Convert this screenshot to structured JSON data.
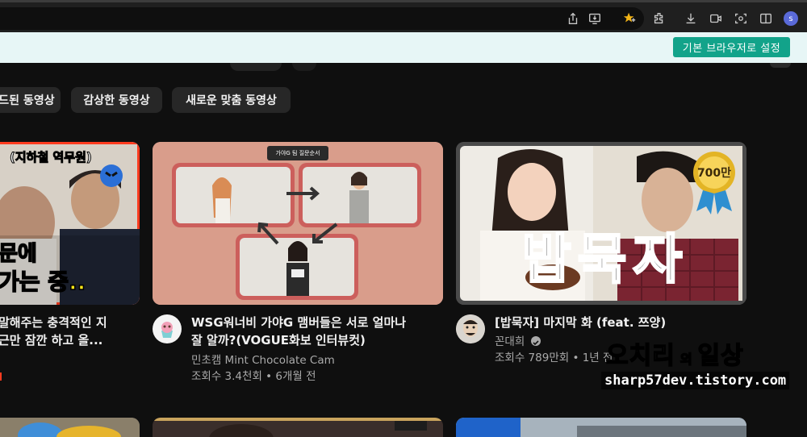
{
  "browser": {
    "profile_initial": "s",
    "infobar_button": "기본 브라우저로 설정",
    "icons": [
      "share-icon",
      "install-app-icon",
      "favorites-star-icon",
      "extensions-icon",
      "download-icon",
      "video-icon",
      "screenshot-icon",
      "split-view-icon"
    ]
  },
  "chips": [
    "로드된 동영상",
    "감상한 동영상",
    "새로운 맞춤 동영상"
  ],
  "videos": [
    {
      "title_line1": "말해주는 충격적인 지",
      "title_line2": "근만 잠깐 하고 올...",
      "thumb_top_text": "(지하철 역무원)",
      "thumb_bottom_line1": "문에",
      "thumb_bottom_line2": "가는 중.."
    },
    {
      "title_line1": "WSG워너비 가야G 맴버들은 서로 얼마나",
      "title_line2": "잘 알까?(VOGUE화보 인터뷰컷)",
      "channel": "민초캠 Mint Chocolate Cam",
      "stats": "조회수 3.4천회 • 6개월 전",
      "thumb_label": "가야G 팀 질문순서"
    },
    {
      "title_line1": "[밥묵자] 마지막 화 (feat. 쯔양)",
      "channel": "꼰대희",
      "stats": "조회수 789만회 • 1년 전",
      "thumb_overlay": "밥묵자",
      "thumb_badge": "700만"
    }
  ],
  "watermark": {
    "main": "오치리",
    "small": "의",
    "tail": "일상",
    "url": "sharp57dev.tistory.com"
  },
  "colors": {
    "page_bg": "#0f0f0f",
    "infobar_bg": "#e7f6f6",
    "infobar_button": "#12a38a",
    "chip_bg": "#272727",
    "thumb2_bg": "#d99d8b"
  }
}
